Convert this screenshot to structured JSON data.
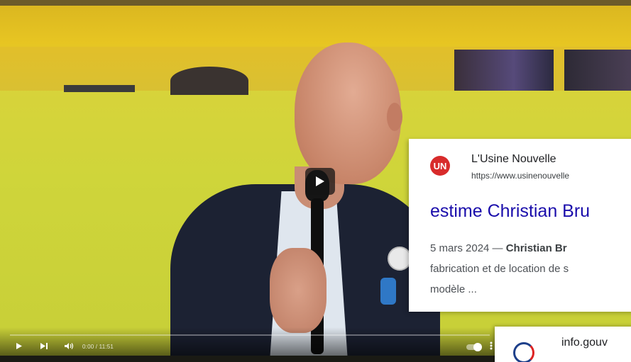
{
  "video": {
    "time_display": "0:00 / 11:51"
  },
  "search_result": {
    "logo_text": "UN",
    "site_name": "L'Usine Nouvelle",
    "site_url": "https://www.usinenouvelle",
    "title": "estime Christian Bru",
    "snippet_date": "5 mars 2024 — ",
    "snippet_bold": "Christian Br",
    "snippet_line2": "fabrication et de location de s",
    "snippet_line3": "modèle ..."
  },
  "search_result_2": {
    "site_name": "info.gouv"
  },
  "colors": {
    "link": "#1a0dab",
    "logo_red": "#d82b2b"
  },
  "icons": [
    "play-icon",
    "skip-next-icon",
    "volume-icon",
    "more-icon"
  ]
}
